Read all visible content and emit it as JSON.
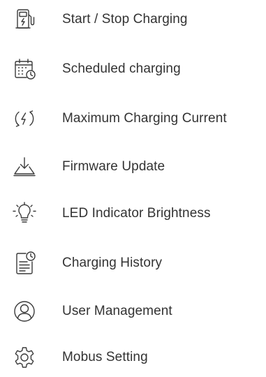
{
  "menu": {
    "items": [
      {
        "label": "Start / Stop Charging",
        "icon": "charging-station-icon"
      },
      {
        "label": "Scheduled charging",
        "icon": "calendar-clock-icon"
      },
      {
        "label": "Maximum Charging Current",
        "icon": "current-cycle-icon"
      },
      {
        "label": "Firmware Update",
        "icon": "download-tray-icon"
      },
      {
        "label": "LED Indicator Brightness",
        "icon": "lightbulb-icon"
      },
      {
        "label": "Charging History",
        "icon": "document-clock-icon"
      },
      {
        "label": "User Management",
        "icon": "user-circle-icon"
      },
      {
        "label": "Mobus Setting",
        "icon": "gear-icon"
      }
    ]
  },
  "colors": {
    "text": "#333333",
    "icon_stroke": "#3a3a3a",
    "background": "#ffffff"
  }
}
